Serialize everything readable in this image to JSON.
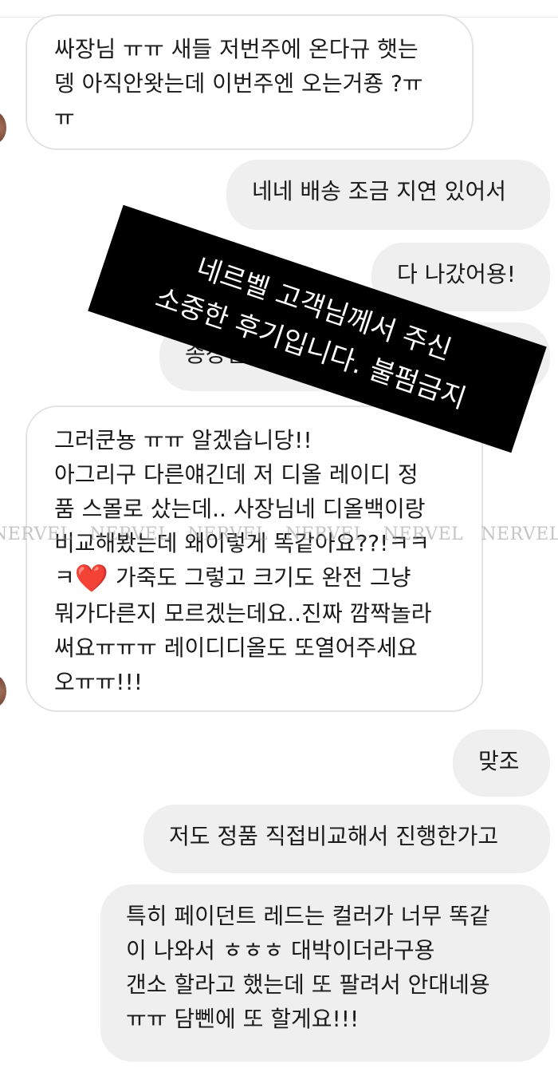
{
  "top_fragment": "",
  "messages": [
    {
      "id": "m1",
      "side": "in",
      "lines": [
        "싸장님 ㅠㅠ 새들 저번주에 온다규 햇는",
        "뎅 아직안왓는데 이번주엔 오는거죵 ?ㅠ",
        "ㅠ"
      ]
    },
    {
      "id": "m2",
      "side": "out",
      "lines": [
        "네네 배송 조금 지연 있어서"
      ]
    },
    {
      "id": "m3",
      "side": "out",
      "lines": [
        "다 나갔어용!"
      ]
    },
    {
      "id": "m4",
      "side": "out",
      "lines": [
        "송장입"
      ]
    },
    {
      "id": "m5",
      "side": "in",
      "lines": [
        "그러쿤뇽 ㅠㅠ 알겠습니당!!",
        "아그리구 다른얘긴데 저 디올 레이디 정",
        "품 스몰로 샀는데.. 사장님네 디올백이랑",
        "비교해봤는데 왜이렇게 똑같아요??!ㅋㅋ",
        "ㅋ",
        "가죽도 그렇고 크기도 완전 그냥",
        "뭐가다른지 모르겠는데요..진짜 깜짝놀라",
        "써요ㅠㅠㅠ 레이디디올도 또열어주세요",
        "오ㅠㅠ!!!"
      ]
    },
    {
      "id": "m6",
      "side": "out",
      "lines": [
        "맞조"
      ]
    },
    {
      "id": "m7",
      "side": "out",
      "lines": [
        "저도 정품 직접비교해서 진행한가고"
      ]
    },
    {
      "id": "m8",
      "side": "out",
      "lines": [
        "특히 페이던트 레드는 컬러가 너무 똑같",
        "이 나와서 ㅎㅎㅎ 대박이더라구용",
        "갠소 할라고 했는데 또 팔려서 안대네용",
        "ㅠㅠ 담뻰에 또 할게요!!!"
      ]
    }
  ],
  "heart_emoji": "❤️",
  "overlay": {
    "line1": "네르벨 고객님께서 주신",
    "line2": "소중한 후기입니다. 불펌금지"
  },
  "watermark": {
    "text": "NERVEL",
    "count": 7
  }
}
